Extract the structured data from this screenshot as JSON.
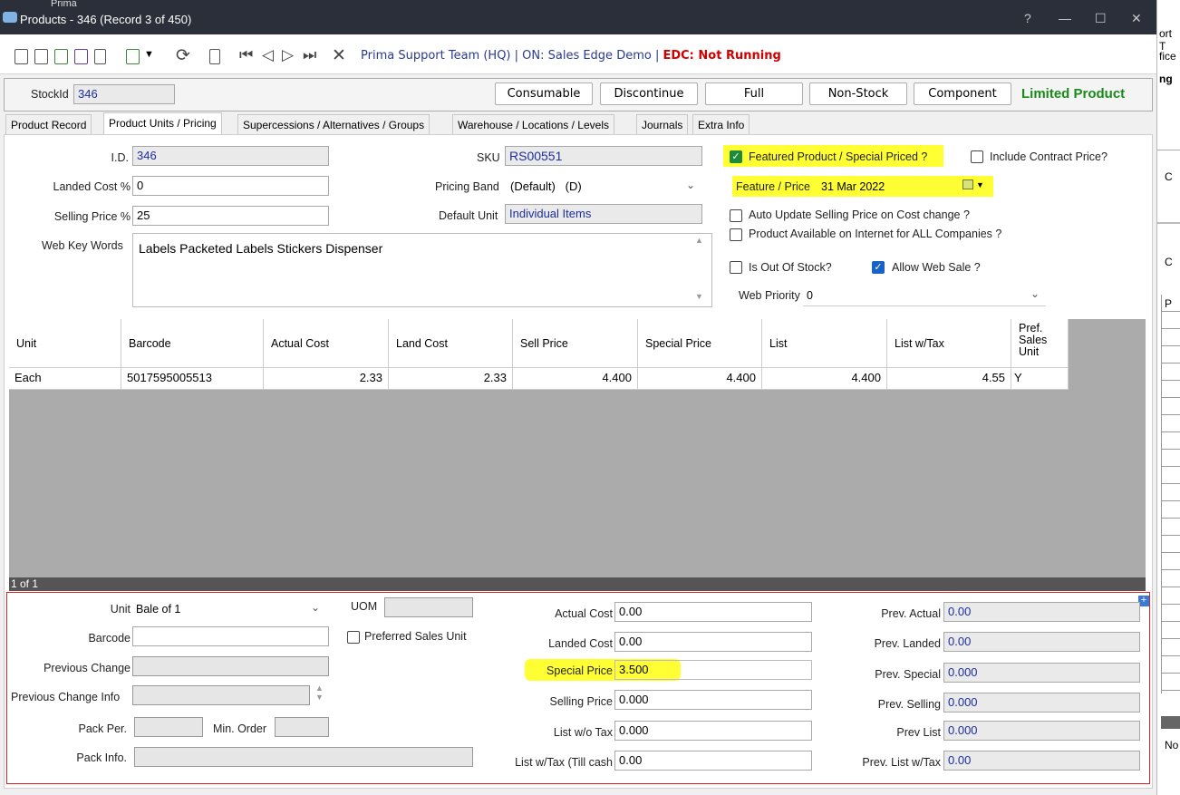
{
  "window": {
    "title": "Products - 346  (Record 3 of 450)",
    "controls": [
      "?",
      "—",
      "☐",
      "✕"
    ],
    "behind_text": {
      "top_left": "Prima",
      "right_lines": [
        "ort T",
        "fice",
        "ng",
        "C",
        "P",
        "No"
      ]
    }
  },
  "toolbar": {
    "context_text": "Prima Support Team (HQ) | ON: Sales Edge Demo | ",
    "edc_status": "EDC: Not Running",
    "icons": [
      "new-icon",
      "save-icon",
      "save-new-icon",
      "save-copy-icon",
      "delete-icon",
      "add-icon",
      "dropdown-icon",
      "refresh-icon",
      "clipboard-icon",
      "first-icon",
      "prev-icon",
      "next-icon",
      "last-icon",
      "tools-icon"
    ]
  },
  "stock": {
    "label": "StockId",
    "value": "346",
    "buttons": [
      "Consumable",
      "Discontinue",
      "Full",
      "Non-Stock",
      "Component"
    ],
    "status": "Limited Product"
  },
  "tabs": [
    "Product Record",
    "Product Units / Pricing",
    "Supercessions / Alternatives / Groups",
    "Warehouse / Locations / Levels",
    "Journals",
    "Extra Info"
  ],
  "active_tab": "Product Units / Pricing",
  "form": {
    "id_label": "I.D.",
    "id_value": "346",
    "landed_label": "Landed Cost %",
    "landed_value": "0",
    "selling_label": "Selling Price %",
    "selling_value": "25",
    "keywords_label": "Web Key Words",
    "keywords_value": "Labels Packeted Labels Stickers Dispenser",
    "sku_label": "SKU",
    "sku_value": "RS00551",
    "band_label": "Pricing Band",
    "band_value": "(Default)   (D)",
    "unit_label": "Default Unit",
    "unit_value": "Individual Items",
    "featured_label": "Featured Product / Special Priced ?",
    "contract_label": "Include Contract Price?",
    "feature_price_label": "Feature / Price",
    "feature_price_value": "31 Mar 2022",
    "auto_update_label": "Auto Update Selling Price on Cost change ?",
    "available_label": "Product Available on Internet for ALL Companies ?",
    "out_of_stock_label": "Is Out Of Stock?",
    "web_sale_label": "Allow Web Sale ?",
    "priority_label": "Web Priority",
    "priority_value": "0"
  },
  "checks": {
    "featured": true,
    "contract": false,
    "auto_update": false,
    "available": false,
    "out_of_stock": false,
    "web_sale": true
  },
  "grid": {
    "headers": [
      "Unit",
      "Barcode",
      "Actual Cost",
      "Land Cost",
      "Sell Price",
      "Special Price",
      "List",
      "List w/Tax",
      "Pref. Sales Unit"
    ],
    "rows": [
      [
        "Each",
        "5017595005513",
        "2.33",
        "2.33",
        "4.400",
        "4.400",
        "4.400",
        "4.55",
        "Y"
      ]
    ],
    "status": "1 of 1"
  },
  "detail": {
    "unit_label": "Unit",
    "unit_value": "Bale of 1",
    "uom_label": "UOM",
    "uom_value": "",
    "barcode_label": "Barcode",
    "barcode_value": "",
    "pref_label": "Preferred Sales Unit",
    "prev_change_label": "Previous Change",
    "prev_change_value": "",
    "prev_info_label": "Previous Change Info",
    "prev_info_value": "",
    "pack_per_label": "Pack Per.",
    "pack_per_value": "",
    "min_order_label": "Min. Order",
    "min_order_value": "",
    "pack_info_label": "Pack Info.",
    "pack_info_value": "",
    "actual_cost_label": "Actual Cost",
    "actual_cost_value": "0.00",
    "landed_cost_label": "Landed Cost",
    "landed_cost_value": "0.00",
    "special_label": "Special Price",
    "special_value": "3.500",
    "selling_label": "Selling Price",
    "selling_value": "0.000",
    "list_wo_label": "List w/o Tax",
    "list_wo_value": "0.000",
    "list_w_label": "List w/Tax (Till cash",
    "list_w_value": "0.00",
    "prev_actual_label": "Prev. Actual",
    "prev_actual_value": "0.00",
    "prev_landed_label": "Prev. Landed",
    "prev_landed_value": "0.00",
    "prev_special_label": "Prev. Special",
    "prev_special_value": "0.000",
    "prev_selling_label": "Prev. Selling",
    "prev_selling_value": "0.000",
    "prev_list_label": "Prev List",
    "prev_list_value": "0.000",
    "prev_list_tax_label": "Prev. List w/Tax",
    "prev_list_tax_value": "0.00",
    "plus_symbol": "+"
  },
  "colors": {
    "titlebar": "#2b2f3a",
    "highlight": "#ffff33",
    "detail_border": "#e02020",
    "limited": "#1a8a1a",
    "edc": "#d10000",
    "field_text": "#1d2e9a"
  }
}
